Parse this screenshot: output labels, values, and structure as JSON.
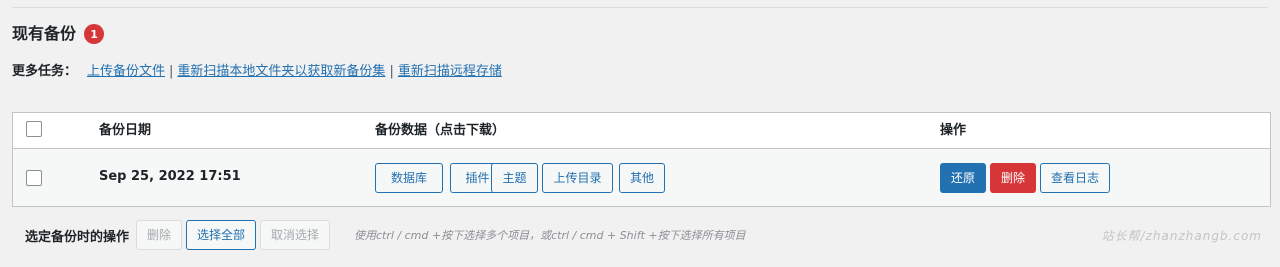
{
  "section": {
    "title": "现有备份",
    "count_badge": "1"
  },
  "more_tasks": {
    "label": "更多任务：",
    "links": [
      {
        "text": "上传备份文件"
      },
      {
        "text": "重新扫描本地文件夹以获取新备份集"
      },
      {
        "text": "重新扫描远程存储"
      }
    ],
    "separator": "|"
  },
  "table": {
    "headers": {
      "date": "备份日期",
      "data": "备份数据（点击下载）",
      "actions": "操作"
    },
    "rows": [
      {
        "date": "Sep 25, 2022 17:51",
        "data_buttons": [
          "数据库",
          "插件",
          "主题",
          "上传目录",
          "其他"
        ],
        "action_buttons": {
          "restore": "还原",
          "delete": "删除",
          "view_log": "查看日志"
        }
      }
    ]
  },
  "bulk": {
    "label": "选定备份时的操作",
    "delete": "删除",
    "select_all": "选择全部",
    "deselect": "取消选择",
    "hint": "使用ctrl / cmd +按下选择多个项目，或ctrl / cmd + Shift +按下选择所有项目"
  },
  "watermark": "站长帮/zhanzhangb.com",
  "colors": {
    "link": "#2271b1",
    "primary": "#2271b1",
    "danger": "#d63638",
    "badge": "#d63638",
    "row_bg": "#f6f7f7"
  }
}
